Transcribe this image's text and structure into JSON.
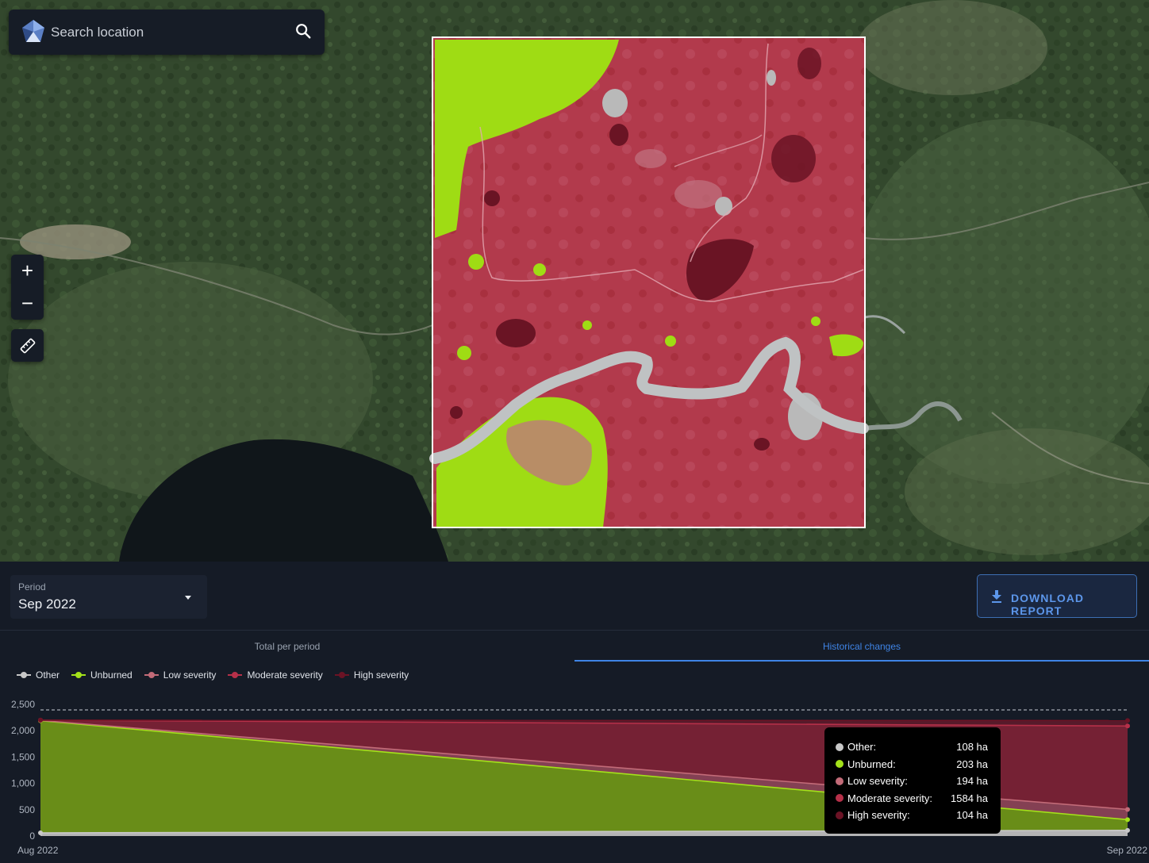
{
  "search": {
    "placeholder": "Search location"
  },
  "map_controls": {
    "zoom_in": "+",
    "zoom_out": "−"
  },
  "period": {
    "label": "Period",
    "value": "Sep 2022"
  },
  "download": {
    "label": "DOWNLOAD REPORT"
  },
  "tabs": [
    {
      "label": "Total per period",
      "active": false
    },
    {
      "label": "Historical changes",
      "active": true
    }
  ],
  "colors": {
    "other": "#c8c8c8",
    "unburned": "#a4e21a",
    "low": "#c26b78",
    "moderate": "#b63049",
    "high": "#6b1325",
    "accent": "#3f84e6"
  },
  "legend": [
    {
      "label": "Other",
      "color": "#c8c8c8"
    },
    {
      "label": "Unburned",
      "color": "#a4e21a"
    },
    {
      "label": "Low severity",
      "color": "#c26b78"
    },
    {
      "label": "Moderate severity",
      "color": "#b63049"
    },
    {
      "label": "High severity",
      "color": "#6b1325"
    }
  ],
  "chart_data": {
    "type": "area",
    "stacked": true,
    "x": [
      "Aug 2022",
      "Sep 2022"
    ],
    "yticks": [
      "0",
      "500",
      "1,000",
      "1,500",
      "2,000",
      "2,500"
    ],
    "ylim": [
      0,
      2500
    ],
    "series": [
      {
        "name": "Other",
        "values": [
          60,
          108
        ]
      },
      {
        "name": "Unburned",
        "values": [
          2130,
          203
        ]
      },
      {
        "name": "Low severity",
        "values": [
          5,
          194
        ]
      },
      {
        "name": "Moderate severity",
        "values": [
          5,
          1584
        ]
      },
      {
        "name": "High severity",
        "values": [
          0,
          104
        ]
      }
    ]
  },
  "tooltip": {
    "rows": [
      {
        "name": "Other:",
        "value": "108 ha",
        "color": "#c8c8c8"
      },
      {
        "name": "Unburned:",
        "value": "203 ha",
        "color": "#a4e21a"
      },
      {
        "name": "Low severity:",
        "value": "194 ha",
        "color": "#c26b78"
      },
      {
        "name": "Moderate severity:",
        "value": "1584 ha",
        "color": "#b63049"
      },
      {
        "name": "High severity:",
        "value": "104 ha",
        "color": "#6b1325"
      }
    ]
  }
}
